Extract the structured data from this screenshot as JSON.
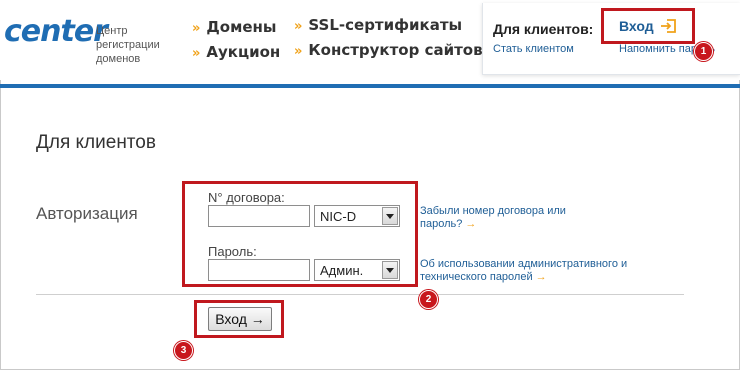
{
  "logo": {
    "text": "center",
    "subtitle": "Центр регистрации доменов"
  },
  "nav": {
    "col1": [
      "Домены",
      "Аукцион"
    ],
    "col2": [
      "SSL-сертификаты",
      "Конструктор сайтов"
    ]
  },
  "client_panel": {
    "title": "Для клиентов:",
    "login": "Вход",
    "become_client": "Стать клиентом",
    "remind_password": "Напомнить пароль"
  },
  "main": {
    "page_title": "Для клиентов",
    "section_label": "Авторизация",
    "contract_label": "N° договора:",
    "contract_value": "",
    "contract_suffix": "NIC-D",
    "password_label": "Пароль:",
    "password_value": "",
    "password_type": "Админ.",
    "forgot_link": "Забыли номер договора или пароль?",
    "admin_link": "Об использовании административного и технического паролей",
    "submit": "Вход →"
  },
  "annotations": [
    "1",
    "2",
    "3"
  ],
  "colors": {
    "brand_blue": "#1f6db3",
    "link_blue": "#1f5e96",
    "accent_orange": "#f0a21a",
    "annotation_red": "#c0181e"
  }
}
